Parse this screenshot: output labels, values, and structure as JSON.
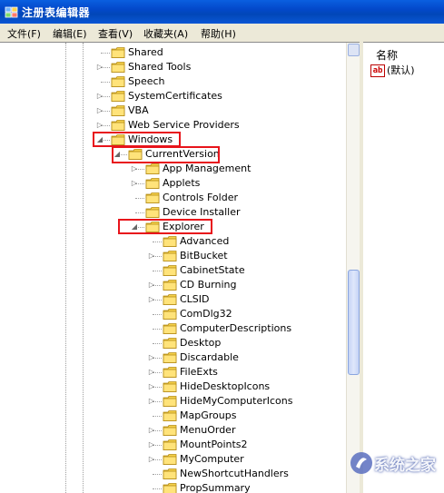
{
  "window": {
    "title": "注册表编辑器"
  },
  "menu": [
    "文件(F)",
    "编辑(E)",
    "查看(V)",
    "收藏夹(A)",
    "帮助(H)"
  ],
  "tree": [
    {
      "label": "Shared",
      "expander": ""
    },
    {
      "label": "Shared Tools",
      "expander": "closed"
    },
    {
      "label": "Speech",
      "expander": ""
    },
    {
      "label": "SystemCertificates",
      "expander": "closed"
    },
    {
      "label": "VBA",
      "expander": "closed"
    },
    {
      "label": "Web Service Providers",
      "expander": "closed"
    },
    {
      "label": "Windows",
      "expander": "open",
      "highlighted": true
    },
    {
      "label": "CurrentVersion",
      "expander": "open",
      "highlighted": true
    },
    {
      "label": "App Management",
      "expander": "closed"
    },
    {
      "label": "Applets",
      "expander": "closed"
    },
    {
      "label": "Controls Folder",
      "expander": ""
    },
    {
      "label": "Device Installer",
      "expander": ""
    },
    {
      "label": "Explorer",
      "expander": "open",
      "highlighted": true
    },
    {
      "label": "Advanced",
      "expander": ""
    },
    {
      "label": "BitBucket",
      "expander": "closed"
    },
    {
      "label": "CabinetState",
      "expander": ""
    },
    {
      "label": "CD Burning",
      "expander": "closed"
    },
    {
      "label": "CLSID",
      "expander": "closed"
    },
    {
      "label": "ComDlg32",
      "expander": ""
    },
    {
      "label": "ComputerDescriptions",
      "expander": ""
    },
    {
      "label": "Desktop",
      "expander": ""
    },
    {
      "label": "Discardable",
      "expander": "closed"
    },
    {
      "label": "FileExts",
      "expander": "closed"
    },
    {
      "label": "HideDesktopIcons",
      "expander": "closed"
    },
    {
      "label": "HideMyComputerIcons",
      "expander": "closed"
    },
    {
      "label": "MapGroups",
      "expander": ""
    },
    {
      "label": "MenuOrder",
      "expander": "closed"
    },
    {
      "label": "MountPoints2",
      "expander": "closed"
    },
    {
      "label": "MyComputer",
      "expander": "closed"
    },
    {
      "label": "NewShortcutHandlers",
      "expander": ""
    },
    {
      "label": "PropSummary",
      "expander": ""
    }
  ],
  "values_pane": {
    "column_header": "名称",
    "rows": [
      {
        "name": "(默认)",
        "icon": "ab-string-value-icon"
      }
    ]
  },
  "watermark": {
    "text": "系统之家"
  },
  "colors": {
    "titlebar": "#0348c9",
    "highlight_box": "#e8141b",
    "folder": "#f5d14b"
  }
}
